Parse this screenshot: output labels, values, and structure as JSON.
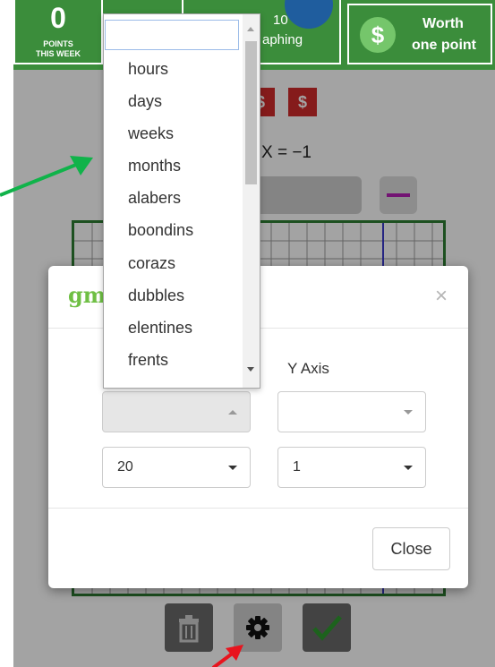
{
  "header": {
    "points_value": "0",
    "points_label_1": "POINTS",
    "points_label_2": "THIS WEEK",
    "graph_text_1": "10",
    "graph_text_2": "aphing",
    "worth_symbol": "$",
    "worth_line_1": "Worth",
    "worth_line_2": "one point"
  },
  "bonus": {
    "dollar_symbol": "$"
  },
  "equation": {
    "text": "X = −1"
  },
  "modal": {
    "logo_text": "gm",
    "close_x": "×",
    "y_axis_label": "Y Axis",
    "x_units_value": "",
    "y_units_value": "",
    "x_scale_value": "20",
    "y_scale_value": "1",
    "close_button_label": "Close"
  },
  "dropdown": {
    "search_value": "",
    "options": [
      "hours",
      "days",
      "weeks",
      "months",
      "alabers",
      "boondins",
      "corazs",
      "dubbles",
      "elentines",
      "frents"
    ]
  },
  "colors": {
    "header_green": "#3b8d3b",
    "accent_red": "#d12b2b",
    "line_purple": "#b41fb4",
    "logo_green": "#6fbf44",
    "arrow_green": "#10b34a",
    "arrow_red": "#e8141e"
  },
  "icons": [
    "dollar-icon",
    "trash-icon",
    "gear-icon",
    "check-icon",
    "close-icon",
    "chevron-down-icon"
  ]
}
